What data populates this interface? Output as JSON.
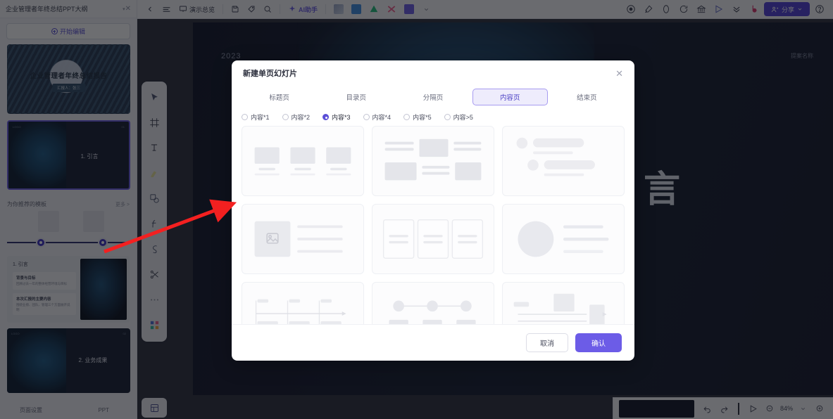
{
  "sidebar": {
    "title": "企业管理者年终总结PPT大纲",
    "close_icon": "close-icon",
    "new_button": "开始编辑",
    "slides": [
      {
        "title": "企业管理者年终总结报告",
        "subtitle": "汇报人：张三",
        "corner_left": "LOGO",
        "corner_right": "2023"
      },
      {
        "title": "1. 引言",
        "corner_left": "LOGO",
        "corner_right": "01"
      },
      {
        "title": "2. 业务成果",
        "corner_left": "LOGO",
        "corner_right": "02"
      }
    ],
    "section_title": "为你推荐的模板",
    "section_more": "更多 >",
    "detail": {
      "head": "1. 引言",
      "blocks": [
        {
          "title": "背景与目标",
          "sub": "回顾过去一年的整体经营环境与目标"
        },
        {
          "title": "本次汇报的主要内容",
          "sub": "围绕业绩、团队、管理三个方面展开说明"
        }
      ]
    },
    "footer_left": "页面设置",
    "footer_right": "PPT"
  },
  "toolbar": {
    "back_icon": "chevron-left-icon",
    "menu_icon": "hamburger-menu-icon",
    "outline_label": "演示总览",
    "outline_icon": "presentation-icon",
    "save_icon": "save-icon",
    "tag_icon": "tag-icon",
    "search_icon": "search-icon",
    "ai_label": "AI助手",
    "ai_icon": "sparkle-icon",
    "swatches": [
      "#9aa7c7",
      "#3f8ee0",
      "#1fbf7a",
      "#f25c8a",
      "#6c5ce7"
    ],
    "more_icon": "chevron-down-icon",
    "right_icons": [
      "record-icon",
      "brush-icon",
      "history-icon",
      "undo-circle-icon",
      "bank-icon",
      "send-icon",
      "collapse-icon"
    ],
    "brand_icon": "b-logo-icon",
    "share_label": "分享",
    "share_icon": "share-person-icon",
    "share_chevron": "chevron-down-icon",
    "help_icon": "help-circle-icon"
  },
  "tool_rail": {
    "icons": [
      "cursor-select-icon",
      "frame-icon",
      "text-icon",
      "highlighter-icon",
      "shapes-icon",
      "formula-icon",
      "pen-draw-icon",
      "scissors-icon",
      "more-dots-icon",
      "apps-grid-icon"
    ],
    "bottom_icon": "layers-icon"
  },
  "canvas": {
    "year": "2023",
    "corner_label": "提案名称",
    "big_text": "言"
  },
  "bottombar": {
    "undo_icon": "undo-icon",
    "redo_icon": "redo-icon",
    "play_icon": "play-icon",
    "zoom_out_icon": "zoom-out-icon",
    "zoom_level": "84%",
    "zoom_chevron": "chevron-down-icon",
    "zoom_in_icon": "zoom-in-icon"
  },
  "modal": {
    "title": "新建单页幻灯片",
    "close_icon": "close-icon",
    "tabs": [
      {
        "label": "标题页",
        "active": false
      },
      {
        "label": "目录页",
        "active": false
      },
      {
        "label": "分隔页",
        "active": false
      },
      {
        "label": "内容页",
        "active": true
      },
      {
        "label": "结束页",
        "active": false
      }
    ],
    "radios": [
      {
        "label": "内容*1",
        "checked": false
      },
      {
        "label": "内容*2",
        "checked": false
      },
      {
        "label": "内容*3",
        "checked": true
      },
      {
        "label": "内容*4",
        "checked": false
      },
      {
        "label": "内容*5",
        "checked": false
      },
      {
        "label": "内容>5",
        "checked": false
      }
    ],
    "cards": [
      {
        "id": "three-cards-row",
        "layout": "three-box-caption"
      },
      {
        "id": "mixed-blocks",
        "layout": "mixed-blocks"
      },
      {
        "id": "pill-list",
        "layout": "pill-list"
      },
      {
        "id": "image-and-lines",
        "layout": "image-lines"
      },
      {
        "id": "three-panels",
        "layout": "three-panels"
      },
      {
        "id": "circle-and-lines",
        "layout": "circle-lines"
      },
      {
        "id": "timeline-steps",
        "layout": "timeline-steps"
      },
      {
        "id": "process-nodes",
        "layout": "process-nodes"
      },
      {
        "id": "flow-boxes",
        "layout": "flow-boxes"
      }
    ],
    "cancel_label": "取消",
    "confirm_label": "确认",
    "accent_color": "#6c5ce7",
    "active_tab_bg": "#eeecfc"
  },
  "annotation": {
    "arrow_color": "#f32020"
  }
}
